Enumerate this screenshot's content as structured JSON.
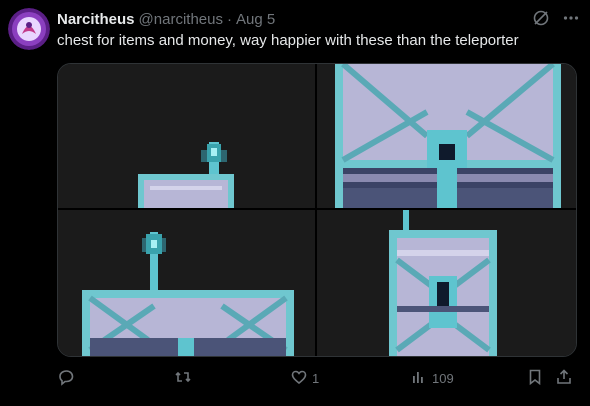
{
  "tweet": {
    "display_name": "Narcitheus",
    "handle": "@narcitheus",
    "separator": "·",
    "date": "Aug 5",
    "text": "chest for items and money, way happier with these than the teleporter"
  },
  "icons": {
    "avatar": "avatar",
    "grok": "grok-icon",
    "more": "more-icon",
    "reply": "reply-icon",
    "retweet": "retweet-icon",
    "like": "like-icon",
    "views": "views-icon",
    "bookmark": "bookmark-icon",
    "share": "share-icon"
  },
  "actions": {
    "likes": "1",
    "views": "109"
  },
  "colors": {
    "background": "#000000",
    "text": "#e7e9ea",
    "muted": "#71767b",
    "chest_body": "#b7b6d6",
    "chest_trim": "#6fc7cf",
    "chest_dark": "#2e3552",
    "avatar_bg": "#7a2aa8"
  }
}
